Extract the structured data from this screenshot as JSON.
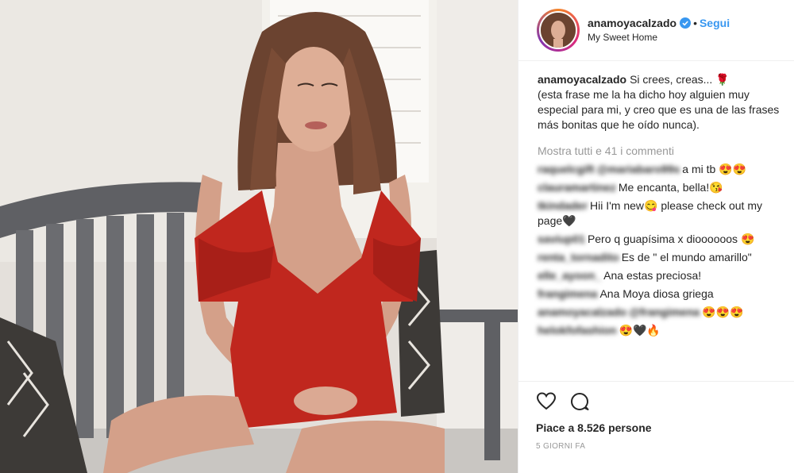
{
  "header": {
    "username": "anamoyacalzado",
    "follow_label": "Segui",
    "dot": "•",
    "location": "My Sweet Home"
  },
  "caption": {
    "username": "anamoyacalzado",
    "text": "Si crees, creas... 🌹\n(esta frase me la ha dicho hoy alguien muy especial para mi, y creo que es una de las frases más bonitas que he oído nunca)."
  },
  "show_all_comments": "Mostra tutti e 41 i commenti",
  "comments": [
    {
      "user": "raquelcgift",
      "mention": "@mariabaro99s",
      "text": "a mi tb 😍😍"
    },
    {
      "user": "clauramartinez",
      "mention": "",
      "text": "Me encanta, bella!😘"
    },
    {
      "user": "tkindader",
      "mention": "",
      "text": "Hii I'm new😋 please check out my page🖤"
    },
    {
      "user": "saviup01",
      "mention": "",
      "text": "Pero q guapísima x dioooooos 😍"
    },
    {
      "user": "renta_tornadito",
      "mention": "",
      "text": "Es de \" el mundo amarillo\""
    },
    {
      "user": "elle_ayoon_",
      "mention": "",
      "text": "Ana estas preciosa!"
    },
    {
      "user": "frangimena",
      "mention": "",
      "text": "Ana Moya diosa griega"
    },
    {
      "user": "anamoyacalzado",
      "mention": "@frangimena",
      "text": "😍😍😍"
    },
    {
      "user": "helokfofashion",
      "mention": "",
      "text": "😍🖤🔥"
    }
  ],
  "likes": {
    "label": "Piace a 8.526 persone"
  },
  "timestamp": "5 giorni fa",
  "icons": {
    "like": "heart-icon",
    "comment": "comment-icon",
    "verified": "verified-badge-icon"
  },
  "colors": {
    "follow": "#3897f0",
    "muted": "#999999",
    "dress": "#c0271e"
  }
}
